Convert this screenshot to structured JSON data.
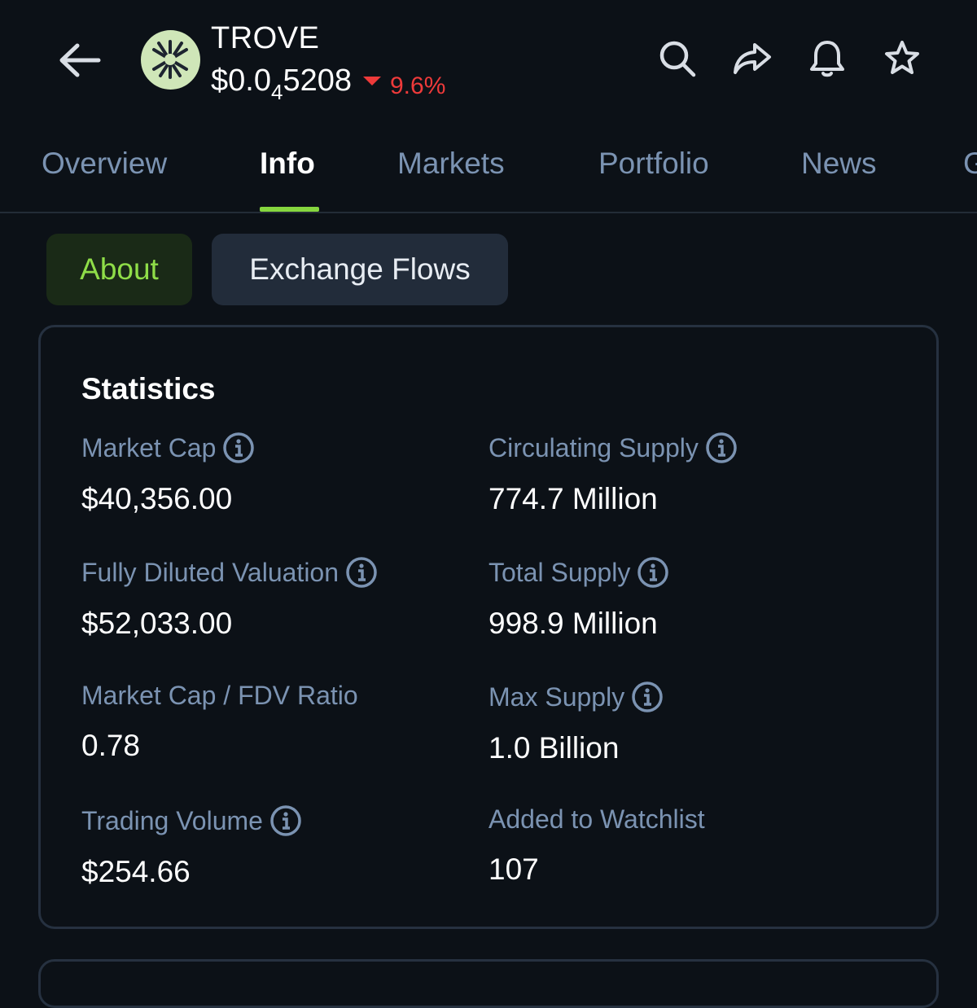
{
  "header": {
    "coin_name": "TROVE",
    "price_main": "$0.0",
    "price_sub": "4",
    "price_tail": "5208",
    "change": "9.6%",
    "change_color": "#ee3a3a",
    "icons": [
      "back-arrow-icon",
      "search-icon",
      "share-icon",
      "bell-icon",
      "star-icon"
    ]
  },
  "tabs": [
    {
      "label": "Overview"
    },
    {
      "label": "Info",
      "active": true
    },
    {
      "label": "Markets"
    },
    {
      "label": "Portfolio"
    },
    {
      "label": "News"
    },
    {
      "label": "G"
    }
  ],
  "subtabs": {
    "about": "About",
    "exchange_flows": "Exchange Flows"
  },
  "statistics": {
    "title": "Statistics",
    "items": [
      {
        "label": "Market Cap",
        "value": "$40,356.00",
        "info": true
      },
      {
        "label": "Circulating Supply",
        "value": "774.7 Million",
        "info": true
      },
      {
        "label": "Fully Diluted Valuation",
        "value": "$52,033.00",
        "info": true
      },
      {
        "label": "Total Supply",
        "value": "998.9 Million",
        "info": true
      },
      {
        "label": "Market Cap / FDV Ratio",
        "value": "0.78",
        "info": false
      },
      {
        "label": "Max Supply",
        "value": "1.0 Billion",
        "info": true
      },
      {
        "label": "Trading Volume",
        "value": "$254.66",
        "info": true
      },
      {
        "label": "Added to Watchlist",
        "value": "107",
        "info": false
      }
    ]
  },
  "colors": {
    "accent": "#86d63f",
    "background": "#0c1117",
    "muted_text": "#7b93b2"
  }
}
